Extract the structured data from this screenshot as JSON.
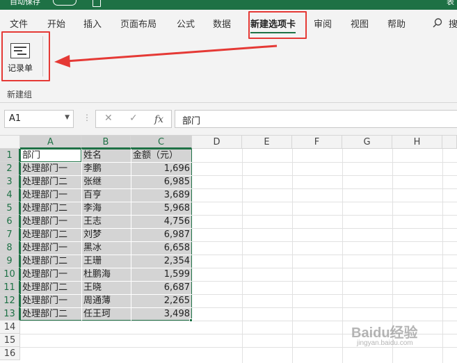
{
  "titlebar": {
    "autosave_label": "自动保存",
    "toggle_state": "关",
    "title_partial": "表"
  },
  "tabs": [
    "文件",
    "开始",
    "插入",
    "页面布局",
    "公式",
    "数据",
    "新建选项卡",
    "审阅",
    "视图",
    "帮助"
  ],
  "tab_active": "新建选项卡",
  "search_partial": "搜",
  "ribbon": {
    "button_label": "记录单",
    "group_label": "新建组"
  },
  "formula_bar": {
    "name_box": "A1",
    "fx_label": "fx",
    "value": "部门"
  },
  "columns": [
    "A",
    "B",
    "C",
    "D",
    "E",
    "F",
    "G",
    "H"
  ],
  "rows": [
    "1",
    "2",
    "3",
    "4",
    "5",
    "6",
    "7",
    "8",
    "9",
    "10",
    "11",
    "12",
    "13",
    "14",
    "15",
    "16"
  ],
  "table": {
    "headers": [
      "部门",
      "姓名",
      "金额（元）"
    ],
    "rows": [
      [
        "处理部门一",
        "李鹏",
        "1,696"
      ],
      [
        "处理部门二",
        "张继",
        "6,985"
      ],
      [
        "处理部门一",
        "百亨",
        "3,689"
      ],
      [
        "处理部门二",
        "李海",
        "5,968"
      ],
      [
        "处理部门一",
        "王志",
        "4,756"
      ],
      [
        "处理部门二",
        "刘梦",
        "6,987"
      ],
      [
        "处理部门一",
        "黑冰",
        "6,658"
      ],
      [
        "处理部门二",
        "王珊",
        "2,354"
      ],
      [
        "处理部门一",
        "杜鹏海",
        "1,599"
      ],
      [
        "处理部门二",
        "王晓",
        "6,687"
      ],
      [
        "处理部门一",
        "周通薄",
        "2,265"
      ],
      [
        "处理部门二",
        "任王珂",
        "3,498"
      ]
    ]
  },
  "watermark": {
    "main": "Baidu经验",
    "sub": "jingyan.baidu.com"
  },
  "colors": {
    "accent": "#1e7145",
    "annotation": "#e53935",
    "selection": "#d4d4d4"
  }
}
